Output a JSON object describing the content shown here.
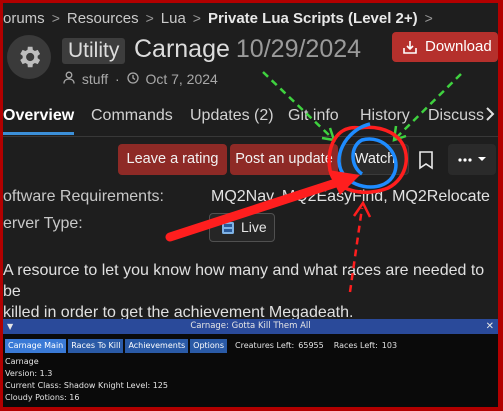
{
  "breadcrumb": {
    "items": [
      "orums",
      "Resources",
      "Lua"
    ],
    "current": "Private Lua Scripts (Level 2+)",
    "separator": ">"
  },
  "header": {
    "tag": "Utility",
    "name": "Carnage",
    "version": "10/29/2024",
    "download_label": "Download",
    "author": "stuff",
    "date": "Oct 7, 2024"
  },
  "tabs": [
    {
      "label": "Overview",
      "active": true
    },
    {
      "label": "Commands",
      "active": false
    },
    {
      "label": "Updates (2)",
      "active": false
    },
    {
      "label": "Git info",
      "active": false
    },
    {
      "label": "History",
      "active": false
    },
    {
      "label": "Discuss",
      "active": false
    }
  ],
  "actions": {
    "rate": "Leave a rating",
    "update": "Post an update",
    "watch": "Watch"
  },
  "requirements": {
    "software_label": "oftware Requirements:",
    "software_value": "MQ2Nav, MQ2EasyFind, MQ2Relocate",
    "server_label": "erver Type:",
    "server_value": "Live"
  },
  "description": {
    "line1": "A resource to let you know how many and what races are needed to be",
    "line2": "killed in order to get the achievement Megadeath."
  },
  "mq_window": {
    "title": "Carnage: Gotta Kill Them All",
    "tabs": [
      "Carnage Main",
      "Races To Kill",
      "Achievements",
      "Options"
    ],
    "creatures_label": "Creatures Left:",
    "creatures_value": "65955",
    "races_label": "Races Left:",
    "races_value": "103",
    "lines": [
      "Carnage",
      "Version: 1.3",
      "Current Class: Shadow Knight   Level: 125",
      "Cloudy Potions: 16"
    ]
  },
  "colors": {
    "frame": "#b20000",
    "accent_red": "#b5302c",
    "active_tab": "#3b8fd8",
    "mq_title": "#2a4a9a",
    "annotation_red": "#ff1e1e",
    "annotation_blue": "#1e8cff",
    "annotation_green": "#3fd23f"
  },
  "icons": [
    "gear-icon",
    "download-icon",
    "user-icon",
    "clock-icon",
    "bookmark-icon",
    "ellipsis-icon",
    "chevron-down-icon",
    "chevron-right-icon",
    "server-icon"
  ]
}
